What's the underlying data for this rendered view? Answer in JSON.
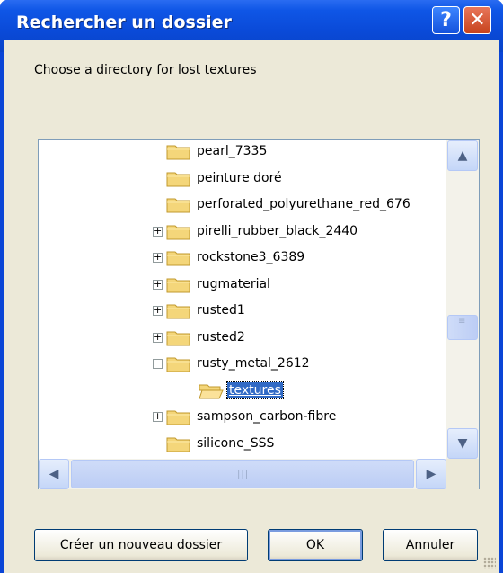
{
  "window": {
    "title": "Rechercher un dossier"
  },
  "titlebar": {
    "help_glyph": "?",
    "close_glyph": "✕"
  },
  "prompt": "Choose a directory for lost textures",
  "tree": {
    "nodes": [
      {
        "label": "pearl_7335",
        "expander": "",
        "level": 1,
        "icon": "folder-closed-icon"
      },
      {
        "label": "peinture doré",
        "expander": "",
        "level": 1,
        "icon": "folder-closed-icon"
      },
      {
        "label": "perforated_polyurethane_red_676",
        "expander": "",
        "level": 1,
        "icon": "folder-closed-icon"
      },
      {
        "label": "pirelli_rubber_black_2440",
        "expander": "+",
        "level": 1,
        "icon": "folder-closed-icon"
      },
      {
        "label": "rockstone3_6389",
        "expander": "+",
        "level": 1,
        "icon": "folder-closed-icon"
      },
      {
        "label": "rugmaterial",
        "expander": "+",
        "level": 1,
        "icon": "folder-closed-icon"
      },
      {
        "label": "rusted1",
        "expander": "+",
        "level": 1,
        "icon": "folder-closed-icon"
      },
      {
        "label": "rusted2",
        "expander": "+",
        "level": 1,
        "icon": "folder-closed-icon"
      },
      {
        "label": "rusty_metal_2612",
        "expander": "−",
        "level": 1,
        "icon": "folder-closed-icon"
      },
      {
        "label": "textures",
        "expander": "",
        "level": 2,
        "icon": "folder-open-icon",
        "selected": true
      },
      {
        "label": "sampson_carbon-fibre",
        "expander": "+",
        "level": 1,
        "icon": "folder-closed-icon"
      },
      {
        "label": "silicone_SSS",
        "expander": "",
        "level": 1,
        "icon": "folder-closed-icon"
      }
    ],
    "vertical_scroll_position": 0.62
  },
  "buttons": {
    "new_folder": "Créer un nouveau dossier",
    "ok": "OK",
    "cancel": "Annuler"
  },
  "colors": {
    "title_bar": "#0a4ad8",
    "selection": "#316ac5",
    "dialog_bg": "#ece9d8"
  }
}
